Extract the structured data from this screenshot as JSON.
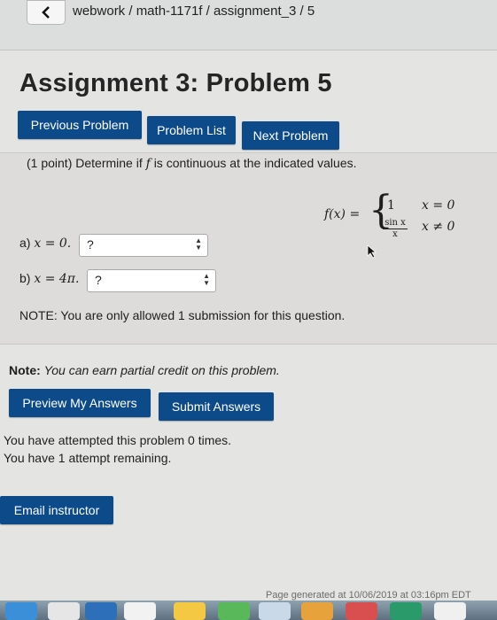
{
  "breadcrumb": "webwork / math-1171f / assignment_3 / 5",
  "title": "Assignment 3: Problem 5",
  "nav": {
    "previous": "Previous Problem",
    "list": "Problem List",
    "next": "Next Problem"
  },
  "problem": {
    "points": "(1 point) Determine if",
    "fvar": "f",
    "question_rest": "is continuous at the indicated values.",
    "formula": {
      "lhs": "f(x) =",
      "case1_value": "1",
      "case1_cond": "x = 0",
      "case2_numerator": "sin x",
      "case2_denominator": "x",
      "case2_cond": "x ≠ 0"
    },
    "part_a": {
      "prefix": "a)",
      "expr": "x = 0.",
      "selected": "?"
    },
    "part_b": {
      "prefix": "b)",
      "expr": "x = 4π.",
      "selected": "?"
    },
    "note": "NOTE: You are only allowed 1 submission for this question."
  },
  "credit_note": {
    "label": "Note:",
    "text": "You can earn partial credit on this problem."
  },
  "actions": {
    "preview": "Preview My Answers",
    "submit": "Submit Answers"
  },
  "attempts": {
    "line1": "You have attempted this problem 0 times.",
    "line2": "You have 1 attempt remaining."
  },
  "email_button": "Email instructor",
  "footer": "Page generated at 10/06/2019 at 03:16pm EDT",
  "colors": {
    "button_blue": "#0c4a8a",
    "panel_gray": "#dddcda"
  }
}
